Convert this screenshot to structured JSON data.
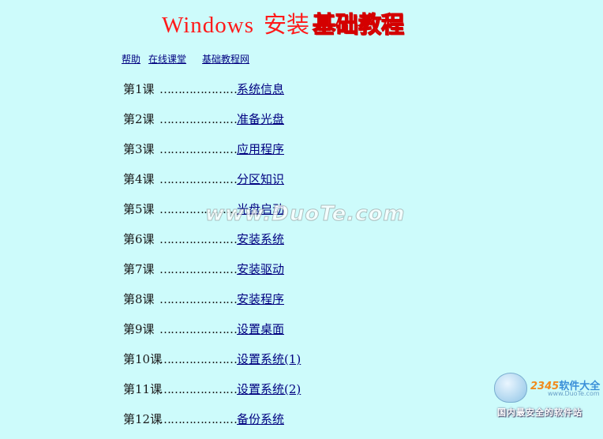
{
  "title": {
    "part1": "Windows",
    "part2": "安装",
    "part3": "基础教程"
  },
  "top_links": [
    "帮助",
    "在线课堂",
    "基础教程网"
  ],
  "lessons": [
    {
      "number": "第1课",
      "dots": "…………………",
      "title": "系统信息"
    },
    {
      "number": "第2课",
      "dots": "…………………",
      "title": "准备光盘"
    },
    {
      "number": "第3课",
      "dots": "…………………",
      "title": "应用程序"
    },
    {
      "number": "第4课",
      "dots": "…………………",
      "title": "分区知识"
    },
    {
      "number": "第5课",
      "dots": "…………………",
      "title": "光盘启动"
    },
    {
      "number": "第6课",
      "dots": "…………………",
      "title": "安装系统"
    },
    {
      "number": "第7课",
      "dots": "…………………",
      "title": "安装驱动"
    },
    {
      "number": "第8课",
      "dots": "…………………",
      "title": "安装程序"
    },
    {
      "number": "第9课",
      "dots": "…………………",
      "title": "设置桌面"
    },
    {
      "number": "第10课",
      "dots": "…………………",
      "title": "设置系统(1)"
    },
    {
      "number": "第11课",
      "dots": "…………………",
      "title": "设置系统(2)"
    },
    {
      "number": "第12课",
      "dots": "…………………",
      "title": "备份系统"
    }
  ],
  "watermark": "www.DuoTe.com",
  "corner_logo": {
    "brand_number": "2345",
    "brand_text": "软件大全",
    "site": "www.DuoTe.com",
    "slogan": "国内最安全的软件站"
  }
}
